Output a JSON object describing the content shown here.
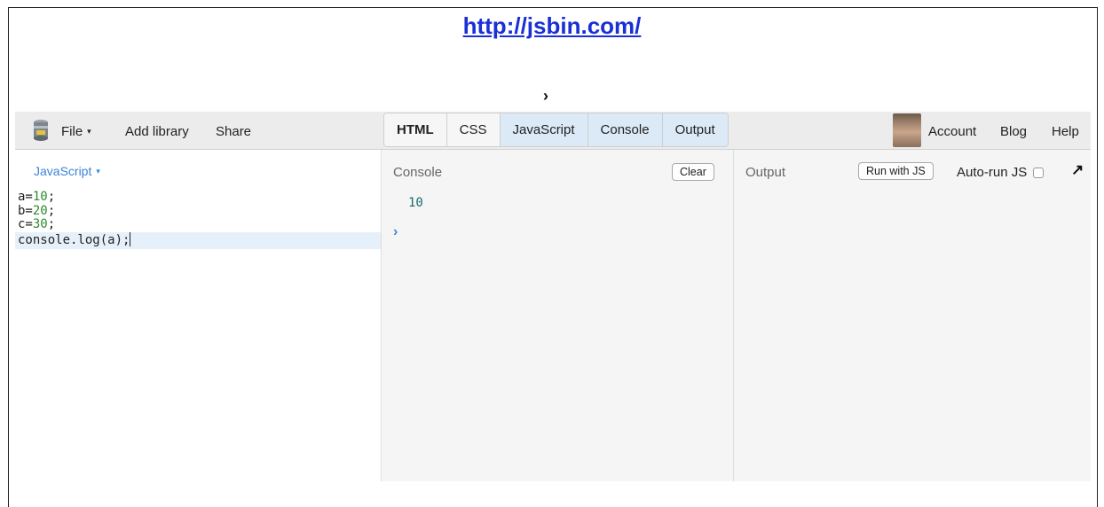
{
  "slide": {
    "link_text": "http://jsbin.com/",
    "chevron": "›"
  },
  "toolbar": {
    "logo_icon": "jsbin-logo-icon",
    "file_label": "File",
    "caret": "▾",
    "add_library_label": "Add library",
    "share_label": "Share",
    "tabs": [
      {
        "label": "HTML",
        "active": false,
        "bold": true
      },
      {
        "label": "CSS",
        "active": false,
        "bold": false
      },
      {
        "label": "JavaScript",
        "active": true,
        "bold": false
      },
      {
        "label": "Console",
        "active": true,
        "bold": false
      },
      {
        "label": "Output",
        "active": true,
        "bold": false
      }
    ],
    "account_label": "Account",
    "blog_label": "Blog",
    "help_label": "Help",
    "active_tab_color": "#dce9f7"
  },
  "js_panel": {
    "language_label": "JavaScript",
    "code_lines": [
      {
        "pre": "a=",
        "num": "10",
        "post": ";"
      },
      {
        "pre": "b=",
        "num": "20",
        "post": ";"
      },
      {
        "pre": "c=",
        "num": "30",
        "post": ";"
      },
      {
        "pre": "console.log(a);",
        "num": "",
        "post": ""
      }
    ]
  },
  "console_panel": {
    "title": "Console",
    "clear_label": "Clear",
    "output_value": "10",
    "prompt": "›"
  },
  "output_panel": {
    "title": "Output",
    "run_label": "Run with JS",
    "autorun_label": "Auto-run JS",
    "autorun_checked": false,
    "popout_icon": "↗"
  }
}
